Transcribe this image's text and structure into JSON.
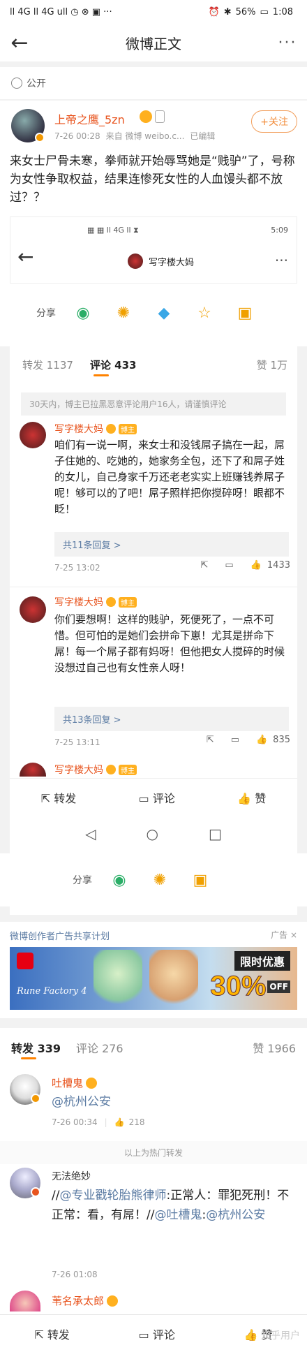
{
  "status_bar": {
    "left": "ll 4G ll 4G ull ◷ ⊗ ▣ ···",
    "battery": "56%",
    "time": "1:08"
  },
  "header": {
    "title": "微博正文",
    "more": "···"
  },
  "visibility": "公开",
  "post": {
    "author": "上帝之鹰_5zn",
    "timestamp": "7-26 00:28",
    "source": "来自 微博 weibo.c...",
    "edited": "已编辑",
    "follow_label": "+关注",
    "text": "来女士尸骨未寒，拳师就开始辱骂她是“贱驴”了，号称为女性争取权益，结果连惨死女性的人血馒头都不放过？？",
    "inner_screenshot": {
      "status_right": "5:09",
      "account_name": "写字楼大妈",
      "share_label": "分享",
      "tabs": {
        "repost_label": "转发 1137",
        "comment_label": "评论 433",
        "like_label": "赞 1万"
      },
      "notice": "30天内，博主已拉黑恶意评论用户16人，请谨慎评论",
      "comments": [
        {
          "name": "写字楼大妈",
          "badge": "博主",
          "text": "咱们有一说一啊，来女士和没钱屌子搞在一起，屌子住她的、吃她的，她家务全包，还下了和屌子姓的女儿，自己身家千万还老老实实上班赚钱养屌子呢！够可以的了吧！屌子照样把你搅碎呀！眼都不眨！",
          "replies": "共11条回复 >",
          "time": "7-25 13:02",
          "likes": "1433"
        },
        {
          "name": "写字楼大妈",
          "badge": "博主",
          "text": "你们要想啊！这样的贱驴，死便死了，一点不可惜。但可怕的是她们会拼命下崽！尤其是拼命下屌！每一个屌子都有妈呀！但他把女人搅碎的时候没想过自己也有女性亲人呀！",
          "replies": "共13条回复 >",
          "time": "7-25 13:11",
          "likes": "835"
        },
        {
          "name": "写字楼大妈",
          "badge": "博主"
        }
      ],
      "bottom_bar": {
        "repost": "转发",
        "comment": "评论",
        "like": "赞"
      }
    },
    "share_label": "分享"
  },
  "ad": {
    "label": "微博创作者广告共享计划",
    "tag": "广告 ×",
    "limited_offer": "限时优惠",
    "percent": "30%",
    "off": "OFF",
    "game_logo": "Rune Factory 4"
  },
  "reposts_section": {
    "repost_tab": "转发 339",
    "comment_tab": "评论 276",
    "like_tab": "赞 1966",
    "items": [
      {
        "name": "吐槽鬼",
        "text": "@杭州公安",
        "time": "7-26 00:34",
        "likes": "218"
      }
    ],
    "hot_divider": "以上为热门转发",
    "items2": [
      {
        "name": "无法绝妙",
        "text_prefix": "//",
        "mention1": "@专业戳轮胎熊律师",
        "text_mid": ":正常人：罪犯死刑！不正常：看，有屌！//",
        "mention2": "@吐槽鬼",
        "text_colon": ":",
        "mention3": "@杭州公安",
        "time": "7-26 01:08"
      },
      {
        "name": "苇名承太郎"
      }
    ]
  },
  "footer": {
    "repost": "转发",
    "comment": "评论",
    "like": "赞",
    "watermark": "知乎用户"
  },
  "colors": {
    "accent": "#ff8200",
    "name": "#e8541e",
    "link": "#5b7ba3"
  }
}
